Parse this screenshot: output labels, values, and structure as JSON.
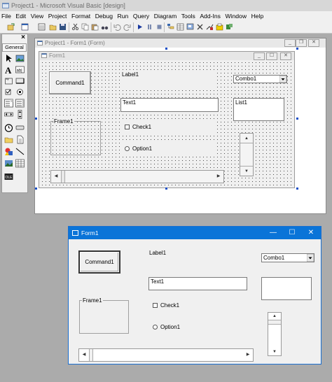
{
  "ide": {
    "title": "Project1 - Microsoft Visual Basic [design]",
    "menu": [
      "File",
      "Edit",
      "View",
      "Project",
      "Format",
      "Debug",
      "Run",
      "Query",
      "Diagram",
      "Tools",
      "Add-Ins",
      "Window",
      "Help"
    ]
  },
  "toolbox": {
    "tab": "General",
    "close": "×",
    "tools": [
      "pointer-icon",
      "picturebox-icon",
      "label-icon",
      "textbox-icon",
      "frame-icon",
      "commandbutton-icon",
      "checkbox-icon",
      "optionbutton-icon",
      "combobox-icon",
      "listbox-icon",
      "hscrollbar-icon",
      "vscrollbar-icon",
      "timer-icon",
      "drivelistbox-icon",
      "dirlistbox-icon",
      "filelistbox-icon",
      "shape-icon",
      "line-icon",
      "image-icon",
      "data-icon",
      "ole-icon"
    ]
  },
  "project_window": {
    "title": "Project1 - Form1 (Form)"
  },
  "design_form": {
    "title": "Form1",
    "command": "Command1",
    "label": "Label1",
    "combo": "Combo1",
    "text": "Text1",
    "list": "List1",
    "frame": "Frame1",
    "check": "Check1",
    "option": "Option1"
  },
  "runtime_form": {
    "title": "Form1",
    "command": "Command1",
    "label": "Label1",
    "combo": "Combo1",
    "text": "Text1",
    "frame": "Frame1",
    "check": "Check1",
    "option": "Option1",
    "minimize": "—",
    "maximize": "☐",
    "close": "✕"
  },
  "colors": {
    "accent": "#0a74d8",
    "selection_handle": "#1a50c8"
  }
}
